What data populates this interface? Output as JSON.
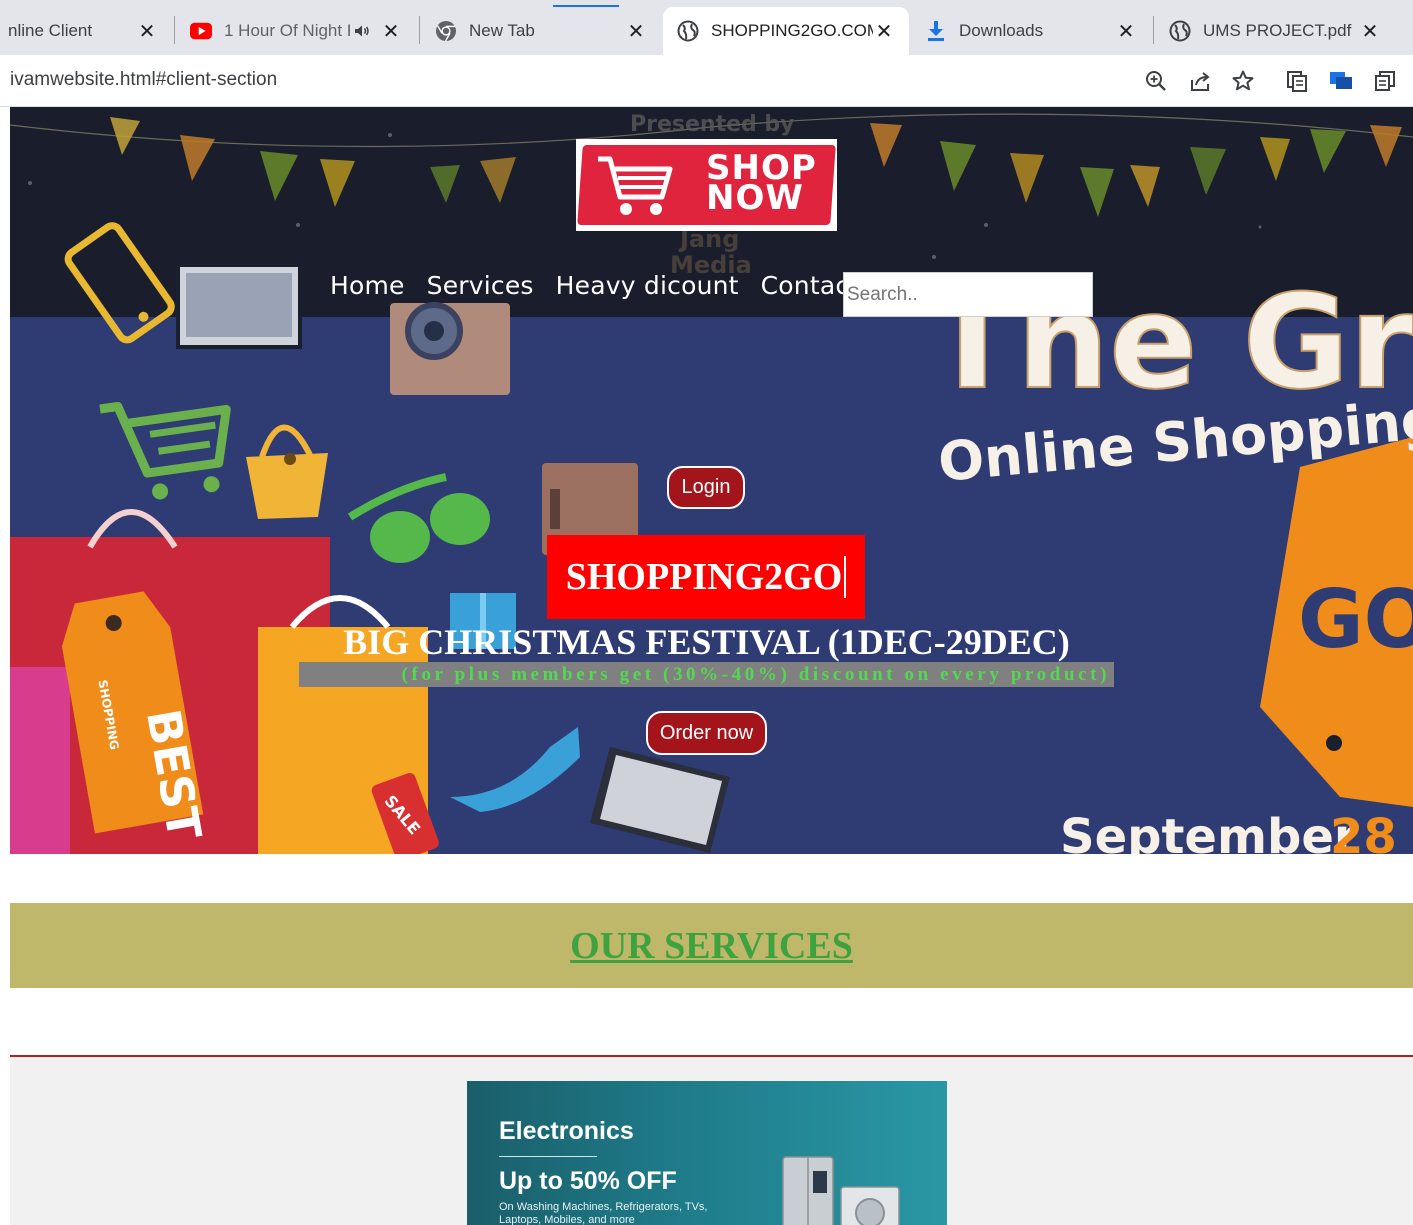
{
  "browser": {
    "tabs": [
      {
        "title": "nline Client",
        "favicon": "none",
        "active": false
      },
      {
        "title": "1 Hour Of Night F",
        "favicon": "youtube-icon",
        "audio": true,
        "active": false
      },
      {
        "title": "New Tab",
        "favicon": "chrome-icon",
        "active": false
      },
      {
        "title": "SHOPPING2GO.COM",
        "favicon": "globe-icon",
        "active": true
      },
      {
        "title": "Downloads",
        "favicon": "download-icon",
        "active": false
      },
      {
        "title": "UMS PROJECT.pdf",
        "favicon": "globe-icon",
        "active": false
      }
    ],
    "close_glyph": "✕",
    "url": "ivamwebsite.html#client-section"
  },
  "header": {
    "logo": {
      "text_line1": "SHOP",
      "text_line2": "NOW"
    },
    "nav": [
      {
        "label": "Home"
      },
      {
        "label": "Services"
      },
      {
        "label": "Heavy dicount"
      },
      {
        "label": "Contact Us"
      }
    ],
    "search_placeholder": "Search.."
  },
  "hero": {
    "login_label": "Login",
    "brand": "SHOPPING2GO",
    "festival": "BIG CHRISTMAS FESTIVAL (1DEC-29DEC)",
    "discount_note": "(for plus members get (30%-40%) discount on every product)",
    "order_label": "Order now",
    "background_text": {
      "top": "Presented by",
      "media1": "Jang",
      "media2": "Media",
      "big": "The Gr",
      "shopping": "Online Shopping",
      "badge": "GO",
      "date": "September",
      "date_num": "28 -",
      "bag": "BEST",
      "bag_small": "SHOPPING",
      "tag": "SALE"
    }
  },
  "services": {
    "title": "OUR SERVICES"
  },
  "promo": {
    "title": "Electronics",
    "offer": "Up to 50% OFF",
    "sub": "On Washing Machines, Refrigerators, TVs, Laptops, Mobiles, and more"
  },
  "colors": {
    "hero_bg": "#2f3b73",
    "header_band": "#191d2c",
    "brand_red": "#ff0000",
    "button_red": "#a4141b",
    "services_band": "#bfb86b",
    "services_title": "#3ea33e"
  }
}
